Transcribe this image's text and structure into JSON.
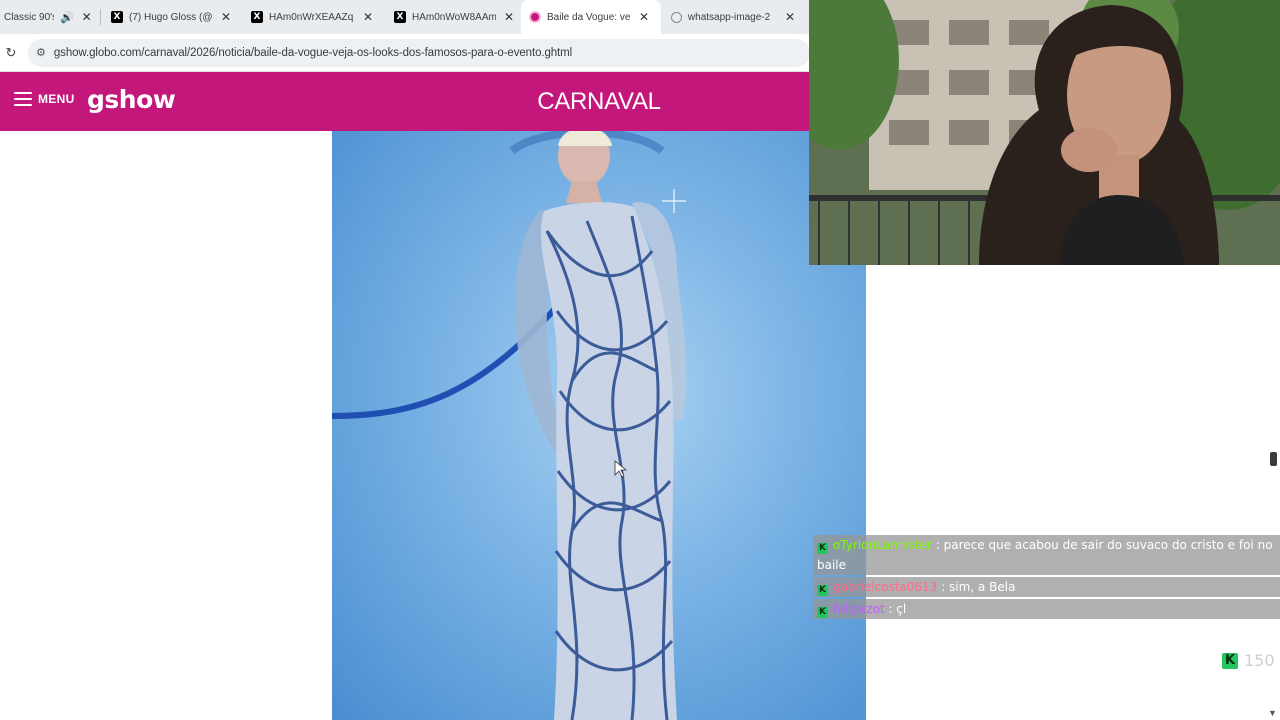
{
  "browser": {
    "tabs": [
      {
        "title": "Classic 90's",
        "icon": "speaker-icon",
        "active": false
      },
      {
        "title": "(7) Hugo Gloss (@",
        "icon": "x-logo-icon",
        "active": false
      },
      {
        "title": "HAm0nWrXEAAZq",
        "icon": "x-logo-icon",
        "active": false
      },
      {
        "title": "HAm0nWoW8AAm",
        "icon": "x-logo-icon",
        "active": false
      },
      {
        "title": "Baile da Vogue: ve",
        "icon": "gshow-favicon-icon",
        "active": true
      },
      {
        "title": "whatsapp-image-2",
        "icon": "globe-icon",
        "active": false
      }
    ],
    "close_glyph": "✕",
    "x_glyph": "X",
    "url": "gshow.globo.com/carnaval/2026/noticia/baile-da-vogue-veja-os-looks-dos-famosos-para-o-evento.ghtml"
  },
  "site": {
    "menu_label": "MENU",
    "brand": "gshow",
    "section_title": "CARNAVAL",
    "brand_color": "#c4177c"
  },
  "stream": {
    "chat": [
      {
        "user": "oTyrionLannister",
        "user_color": "#7CFC00",
        "sep": " : ",
        "text": "parece que acabou de sair do suvaco do cristo e foi no baile"
      },
      {
        "user": "gabrielcosta0613",
        "user_color": "#ff6b8a",
        "sep": " : ",
        "text": "sim, a Bela"
      },
      {
        "user": "felipezot",
        "user_color": "#c45cff",
        "sep": " : ",
        "text": "çl"
      }
    ],
    "badge_letter": "K",
    "viewer_count": "150",
    "accent_color": "#22c55e"
  }
}
